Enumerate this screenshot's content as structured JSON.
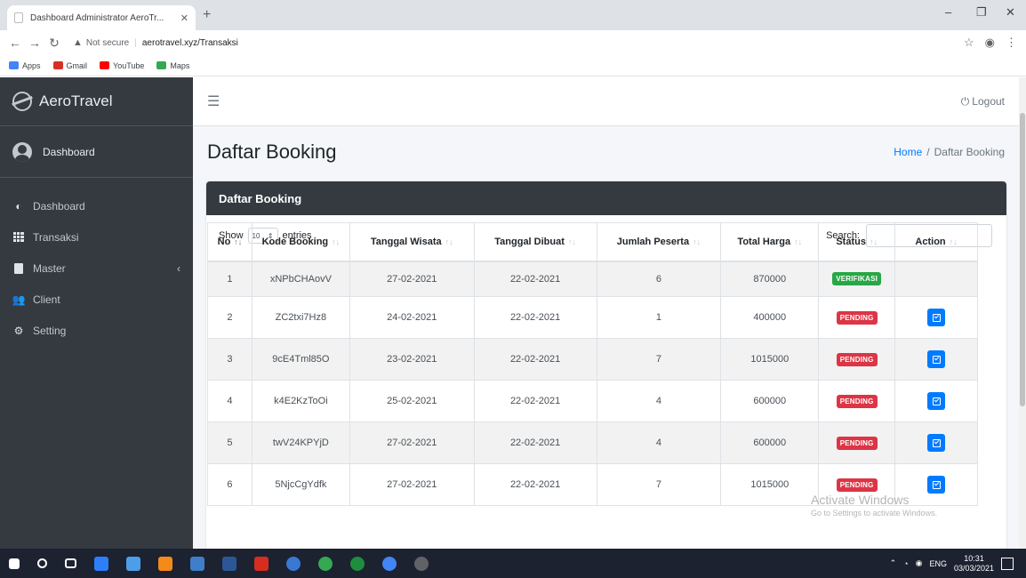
{
  "browser": {
    "tab_title": "Dashboard Administrator AeroTr...",
    "tab_close": "✕",
    "new_tab": "+",
    "security_label": "Not secure",
    "url": "aerotravel.xyz/Transaksi",
    "bookmarks": [
      {
        "label": "Apps",
        "color": "#4285f4"
      },
      {
        "label": "Gmail",
        "color": "#d93025"
      },
      {
        "label": "YouTube",
        "color": "#ff0000"
      },
      {
        "label": "Maps",
        "color": "#34a853"
      }
    ]
  },
  "sidebar": {
    "brand": "AeroTravel",
    "user": "Dashboard",
    "menu": [
      {
        "label": "Dashboard",
        "icon": "dashboard-icon"
      },
      {
        "label": "Transaksi",
        "icon": "table-icon"
      },
      {
        "label": "Master",
        "icon": "book-icon",
        "chevron": "‹"
      },
      {
        "label": "Client",
        "icon": "users-icon"
      },
      {
        "label": "Setting",
        "icon": "gear-icon"
      }
    ]
  },
  "topnav": {
    "menu_icon": "☰",
    "logout": "Logout"
  },
  "page": {
    "title": "Daftar Booking",
    "breadcrumb": {
      "home": "Home",
      "sep": "/",
      "current": "Daftar Booking"
    }
  },
  "card": {
    "header": "Daftar Booking",
    "show_label": "Show",
    "show_value": "10",
    "entries_label": "entries",
    "search_label": "Search:",
    "search_value": ""
  },
  "table": {
    "columns": [
      "No",
      "Kode Booking",
      "Tanggal Wisata",
      "Tanggal Dibuat",
      "Jumlah Peserta",
      "Total Harga",
      "Status",
      "Action"
    ],
    "rows": [
      {
        "no": "1",
        "kode": "xNPbCHAovV",
        "wisata": "27-02-2021",
        "dibuat": "22-02-2021",
        "peserta": "6",
        "harga": "870000",
        "status": "VERIFIKASI",
        "status_type": "success",
        "action": false
      },
      {
        "no": "2",
        "kode": "ZC2txi7Hz8",
        "wisata": "24-02-2021",
        "dibuat": "22-02-2021",
        "peserta": "1",
        "harga": "400000",
        "status": "PENDING",
        "status_type": "danger",
        "action": true
      },
      {
        "no": "3",
        "kode": "9cE4Tml85O",
        "wisata": "23-02-2021",
        "dibuat": "22-02-2021",
        "peserta": "7",
        "harga": "1015000",
        "status": "PENDING",
        "status_type": "danger",
        "action": true
      },
      {
        "no": "4",
        "kode": "k4E2KzToOi",
        "wisata": "25-02-2021",
        "dibuat": "22-02-2021",
        "peserta": "4",
        "harga": "600000",
        "status": "PENDING",
        "status_type": "danger",
        "action": true
      },
      {
        "no": "5",
        "kode": "twV24KPYjD",
        "wisata": "27-02-2021",
        "dibuat": "22-02-2021",
        "peserta": "4",
        "harga": "600000",
        "status": "PENDING",
        "status_type": "danger",
        "action": true
      },
      {
        "no": "6",
        "kode": "5NjcCgYdfk",
        "wisata": "27-02-2021",
        "dibuat": "22-02-2021",
        "peserta": "7",
        "harga": "1015000",
        "status": "PENDING",
        "status_type": "danger",
        "action": true
      }
    ]
  },
  "watermark": {
    "line1": "Activate Windows",
    "line2": "Go to Settings to activate Windows."
  },
  "taskbar": {
    "lang": "ENG",
    "time": "10:31",
    "date": "03/03/2021"
  }
}
